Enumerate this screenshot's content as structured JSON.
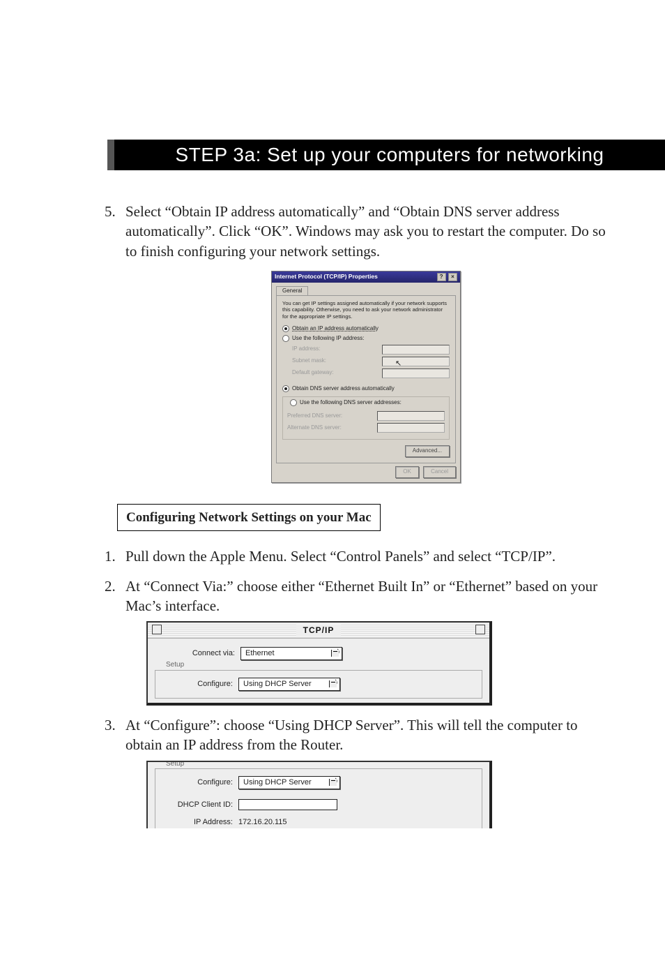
{
  "header": {
    "title": "STEP 3a: Set up your computers for networking"
  },
  "steps": {
    "five": "Select “Obtain IP address automatically” and “Obtain DNS server address automatically”. Click “OK”. Windows may ask you to restart the computer. Do so to finish configuring your network settings."
  },
  "win": {
    "title": "Internet Protocol (TCP/IP) Properties",
    "help_btn": "?",
    "close_btn": "×",
    "tab": "General",
    "note": "You can get IP settings assigned automatically if your network supports this capability. Otherwise, you need to ask your network administrator for the appropriate IP settings.",
    "r1": "Obtain an IP address automatically",
    "r2": "Use the following IP address:",
    "f_ip": "IP address:",
    "f_sub": "Subnet mask:",
    "f_gw": "Default gateway:",
    "r3": "Obtain DNS server address automatically",
    "r4": "Use the following DNS server addresses:",
    "f_pdns": "Preferred DNS server:",
    "f_adns": "Alternate DNS server:",
    "btn_adv": "Advanced...",
    "btn_ok": "OK",
    "btn_cancel": "Cancel"
  },
  "mac_section_title": "Configuring Network Settings on your Mac",
  "mac_steps": {
    "one": "Pull down the Apple Menu. Select “Control Panels” and select “TCP/IP”.",
    "two": "At “Connect Via:” choose either “Ethernet Built In” or “Ethernet” based on your Mac’s interface.",
    "three": "At “Configure”: choose “Using DHCP Server”. This will tell the computer to obtain an IP address from the Router."
  },
  "mac1": {
    "title": "TCP/IP",
    "connect_label": "Connect via:",
    "connect_value": "Ethernet",
    "setup_label": "Setup",
    "configure_label": "Configure:",
    "configure_value": "Using DHCP Server"
  },
  "mac2": {
    "setup_label": "Setup",
    "configure_label": "Configure:",
    "configure_value": "Using DHCP Server",
    "dhcp_label": "DHCP Client ID:",
    "dhcp_value": "",
    "ip_label": "IP Address:",
    "ip_value": "172.16.20.115"
  }
}
